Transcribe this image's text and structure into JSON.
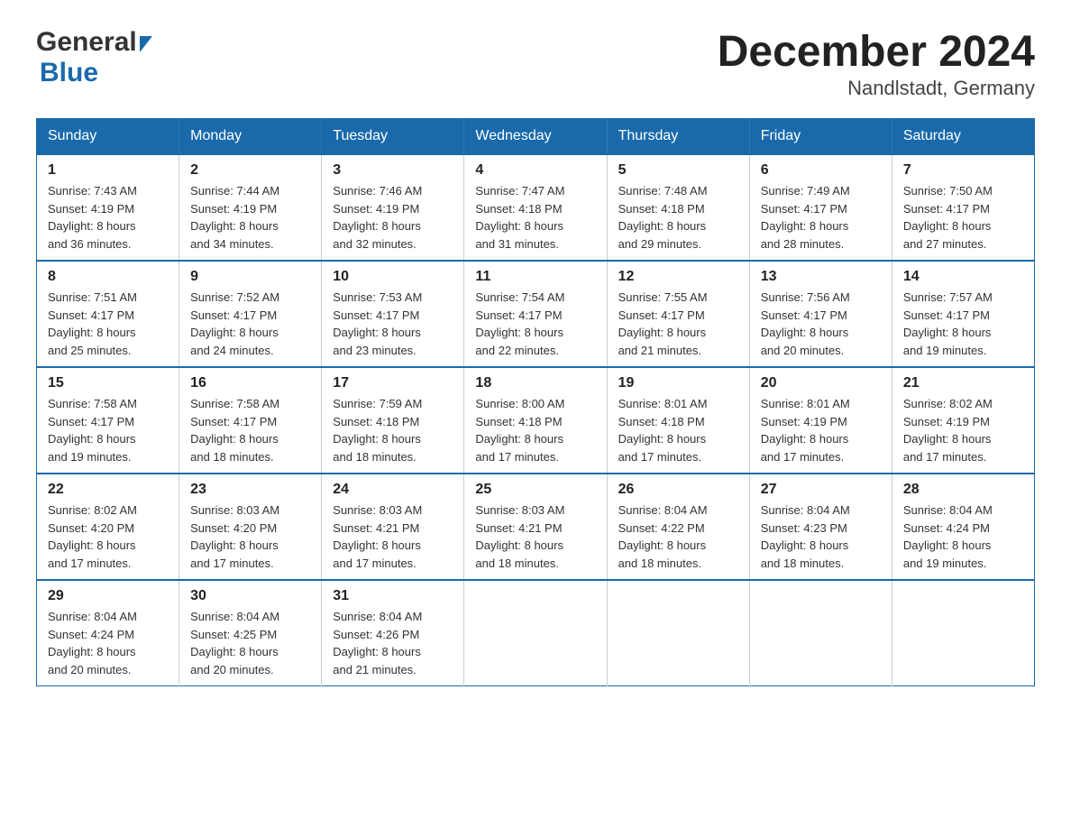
{
  "logo": {
    "general": "General",
    "blue": "Blue"
  },
  "title": "December 2024",
  "subtitle": "Nandlstadt, Germany",
  "weekdays": [
    "Sunday",
    "Monday",
    "Tuesday",
    "Wednesday",
    "Thursday",
    "Friday",
    "Saturday"
  ],
  "weeks": [
    [
      {
        "day": "1",
        "sunrise": "7:43 AM",
        "sunset": "4:19 PM",
        "daylight": "8 hours and 36 minutes."
      },
      {
        "day": "2",
        "sunrise": "7:44 AM",
        "sunset": "4:19 PM",
        "daylight": "8 hours and 34 minutes."
      },
      {
        "day": "3",
        "sunrise": "7:46 AM",
        "sunset": "4:19 PM",
        "daylight": "8 hours and 32 minutes."
      },
      {
        "day": "4",
        "sunrise": "7:47 AM",
        "sunset": "4:18 PM",
        "daylight": "8 hours and 31 minutes."
      },
      {
        "day": "5",
        "sunrise": "7:48 AM",
        "sunset": "4:18 PM",
        "daylight": "8 hours and 29 minutes."
      },
      {
        "day": "6",
        "sunrise": "7:49 AM",
        "sunset": "4:17 PM",
        "daylight": "8 hours and 28 minutes."
      },
      {
        "day": "7",
        "sunrise": "7:50 AM",
        "sunset": "4:17 PM",
        "daylight": "8 hours and 27 minutes."
      }
    ],
    [
      {
        "day": "8",
        "sunrise": "7:51 AM",
        "sunset": "4:17 PM",
        "daylight": "8 hours and 25 minutes."
      },
      {
        "day": "9",
        "sunrise": "7:52 AM",
        "sunset": "4:17 PM",
        "daylight": "8 hours and 24 minutes."
      },
      {
        "day": "10",
        "sunrise": "7:53 AM",
        "sunset": "4:17 PM",
        "daylight": "8 hours and 23 minutes."
      },
      {
        "day": "11",
        "sunrise": "7:54 AM",
        "sunset": "4:17 PM",
        "daylight": "8 hours and 22 minutes."
      },
      {
        "day": "12",
        "sunrise": "7:55 AM",
        "sunset": "4:17 PM",
        "daylight": "8 hours and 21 minutes."
      },
      {
        "day": "13",
        "sunrise": "7:56 AM",
        "sunset": "4:17 PM",
        "daylight": "8 hours and 20 minutes."
      },
      {
        "day": "14",
        "sunrise": "7:57 AM",
        "sunset": "4:17 PM",
        "daylight": "8 hours and 19 minutes."
      }
    ],
    [
      {
        "day": "15",
        "sunrise": "7:58 AM",
        "sunset": "4:17 PM",
        "daylight": "8 hours and 19 minutes."
      },
      {
        "day": "16",
        "sunrise": "7:58 AM",
        "sunset": "4:17 PM",
        "daylight": "8 hours and 18 minutes."
      },
      {
        "day": "17",
        "sunrise": "7:59 AM",
        "sunset": "4:18 PM",
        "daylight": "8 hours and 18 minutes."
      },
      {
        "day": "18",
        "sunrise": "8:00 AM",
        "sunset": "4:18 PM",
        "daylight": "8 hours and 17 minutes."
      },
      {
        "day": "19",
        "sunrise": "8:01 AM",
        "sunset": "4:18 PM",
        "daylight": "8 hours and 17 minutes."
      },
      {
        "day": "20",
        "sunrise": "8:01 AM",
        "sunset": "4:19 PM",
        "daylight": "8 hours and 17 minutes."
      },
      {
        "day": "21",
        "sunrise": "8:02 AM",
        "sunset": "4:19 PM",
        "daylight": "8 hours and 17 minutes."
      }
    ],
    [
      {
        "day": "22",
        "sunrise": "8:02 AM",
        "sunset": "4:20 PM",
        "daylight": "8 hours and 17 minutes."
      },
      {
        "day": "23",
        "sunrise": "8:03 AM",
        "sunset": "4:20 PM",
        "daylight": "8 hours and 17 minutes."
      },
      {
        "day": "24",
        "sunrise": "8:03 AM",
        "sunset": "4:21 PM",
        "daylight": "8 hours and 17 minutes."
      },
      {
        "day": "25",
        "sunrise": "8:03 AM",
        "sunset": "4:21 PM",
        "daylight": "8 hours and 18 minutes."
      },
      {
        "day": "26",
        "sunrise": "8:04 AM",
        "sunset": "4:22 PM",
        "daylight": "8 hours and 18 minutes."
      },
      {
        "day": "27",
        "sunrise": "8:04 AM",
        "sunset": "4:23 PM",
        "daylight": "8 hours and 18 minutes."
      },
      {
        "day": "28",
        "sunrise": "8:04 AM",
        "sunset": "4:24 PM",
        "daylight": "8 hours and 19 minutes."
      }
    ],
    [
      {
        "day": "29",
        "sunrise": "8:04 AM",
        "sunset": "4:24 PM",
        "daylight": "8 hours and 20 minutes."
      },
      {
        "day": "30",
        "sunrise": "8:04 AM",
        "sunset": "4:25 PM",
        "daylight": "8 hours and 20 minutes."
      },
      {
        "day": "31",
        "sunrise": "8:04 AM",
        "sunset": "4:26 PM",
        "daylight": "8 hours and 21 minutes."
      },
      null,
      null,
      null,
      null
    ]
  ],
  "labels": {
    "sunrise": "Sunrise:",
    "sunset": "Sunset:",
    "daylight": "Daylight:"
  },
  "colors": {
    "header_bg": "#1a6aab",
    "header_text": "#ffffff",
    "border": "#1a6aab"
  }
}
